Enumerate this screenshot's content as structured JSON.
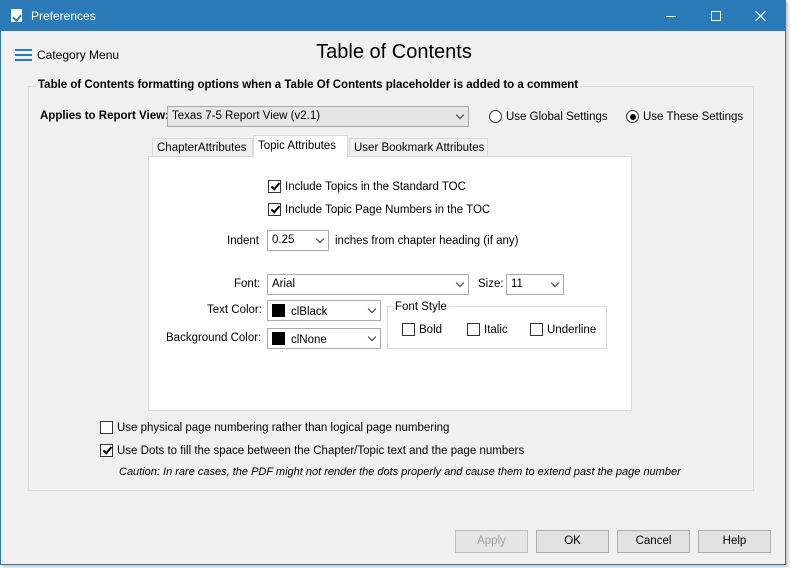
{
  "window": {
    "title": "Preferences"
  },
  "header": {
    "menu_label": "Category Menu",
    "page_title": "Table of Contents"
  },
  "group": {
    "caption": "Table of Contents formatting options when a Table Of Contents placeholder is added to a comment",
    "applies_label": "Applies to Report View:",
    "report_view_value": "Texas 7-5 Report View (v2.1)",
    "radio_global": {
      "label": "Use Global Settings",
      "selected": false
    },
    "radio_these": {
      "label": "Use These Settings",
      "selected": true
    }
  },
  "tabs": [
    {
      "label": "ChapterAttributes",
      "active": false
    },
    {
      "label": "Topic Attributes",
      "active": true
    },
    {
      "label": "User Bookmark Attributes",
      "active": false
    }
  ],
  "topic": {
    "include_topics": {
      "label": "Include Topics in the Standard TOC",
      "checked": true
    },
    "include_page_numbers": {
      "label": "Include Topic Page Numbers in the TOC",
      "checked": true
    },
    "indent_label": "Indent",
    "indent_value": "0.25",
    "indent_suffix": "inches from chapter heading (if any)",
    "font_label": "Font:",
    "font_value": "Arial",
    "size_label": "Size:",
    "size_value": "11",
    "text_color_label": "Text Color:",
    "text_color_value": "clBlack",
    "bg_color_label": "Background Color:",
    "bg_color_value": "clNone",
    "font_style_caption": "Font Style",
    "bold_label": "Bold",
    "italic_label": "Italic",
    "underline_label": "Underline"
  },
  "options": {
    "physical_numbering": {
      "label": "Use physical page numbering rather than logical page numbering",
      "checked": false
    },
    "use_dots": {
      "label": "Use Dots to fill the space between the Chapter/Topic text and the page numbers",
      "checked": true
    },
    "caution": "Caution: In rare cases, the PDF might not render the dots properly and cause them to extend past the page number"
  },
  "buttons": {
    "apply": "Apply",
    "ok": "OK",
    "cancel": "Cancel",
    "help": "Help"
  },
  "colors": {
    "titlebar": "#2b7bb9",
    "swatch_black": "#000000"
  }
}
